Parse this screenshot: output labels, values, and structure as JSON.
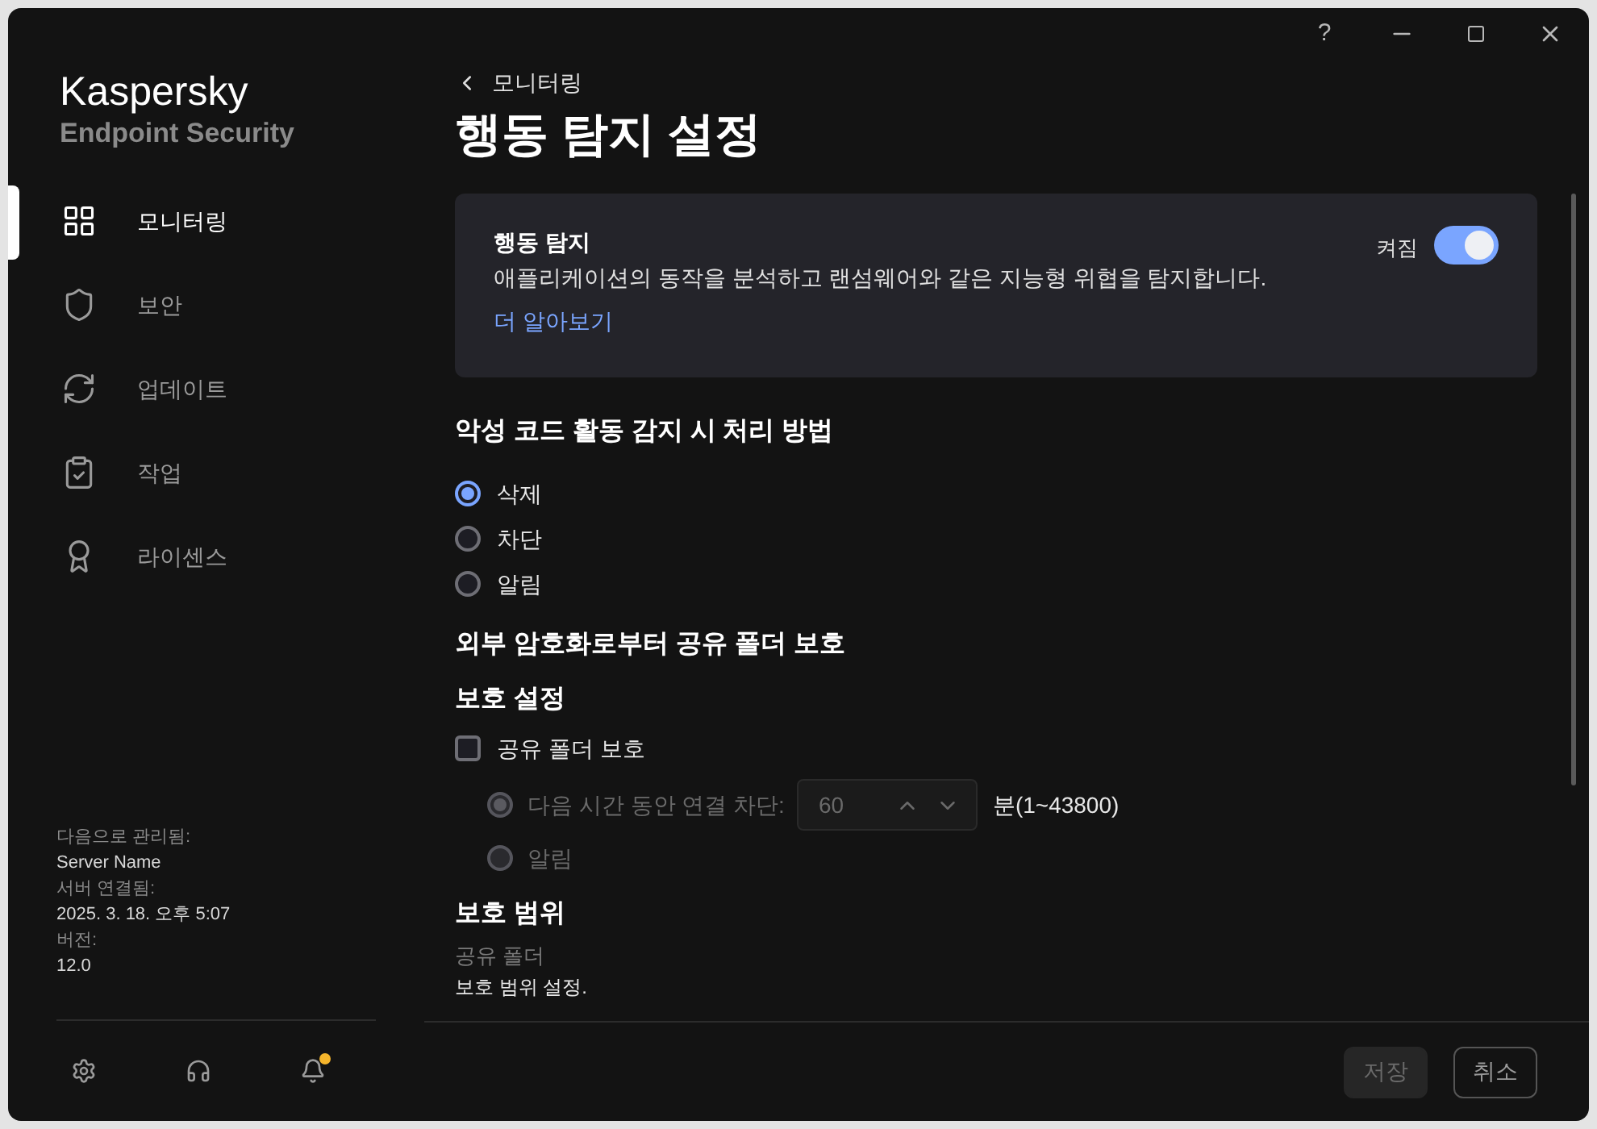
{
  "window": {
    "help_label": "?"
  },
  "sidebar": {
    "product_name": "Kaspersky",
    "product_edition": "Endpoint Security",
    "items": [
      {
        "label": "모니터링",
        "selected": true
      },
      {
        "label": "보안",
        "selected": false
      },
      {
        "label": "업데이트",
        "selected": false
      },
      {
        "label": "작업",
        "selected": false
      },
      {
        "label": "라이센스",
        "selected": false
      }
    ],
    "info": [
      {
        "label": "다음으로 관리됨:",
        "value": "Server Name"
      },
      {
        "label": "서버 연결됨:",
        "value": "2025. 3. 18. 오후 5:07"
      },
      {
        "label": "버전:",
        "value": "12.0"
      }
    ],
    "notifications_unread": true
  },
  "breadcrumb": "모니터링",
  "page_title": "행동 탐지 설정",
  "feature_card": {
    "title": "행동 탐지",
    "description": "애플리케이션의 동작을 분석하고 랜섬웨어와 같은 지능형 위협을 탐지합니다.",
    "link": "더 알아보기",
    "toggle": {
      "label": "켜짐",
      "on": true
    }
  },
  "action_section": {
    "heading": "악성 코드 활동 감지 시 처리 방법",
    "options": [
      {
        "label": "삭제",
        "selected": true
      },
      {
        "label": "차단",
        "selected": false
      },
      {
        "label": "알림",
        "selected": false
      }
    ]
  },
  "shared_folder_section": {
    "heading": "외부 암호화로부터 공유 폴더 보호",
    "subheading": "보호 설정",
    "checkbox": {
      "label": "공유 폴더 보호",
      "checked": false
    },
    "options": [
      {
        "kind": "duration",
        "label": "다음 시간 동안 연결 차단:",
        "value": "60",
        "unit": "분(1~43800)",
        "selected": true,
        "disabled": true
      },
      {
        "kind": "plain",
        "label": "알림",
        "selected": false,
        "disabled": true
      }
    ]
  },
  "scope_section": {
    "heading": "보호 범위",
    "field_label": "공유 폴더",
    "link": "보호 범위 설정."
  },
  "buttons": [
    {
      "kind": "primary",
      "label": "저장",
      "disabled": true
    },
    {
      "kind": "outline",
      "label": "취소",
      "disabled": false
    }
  ]
}
